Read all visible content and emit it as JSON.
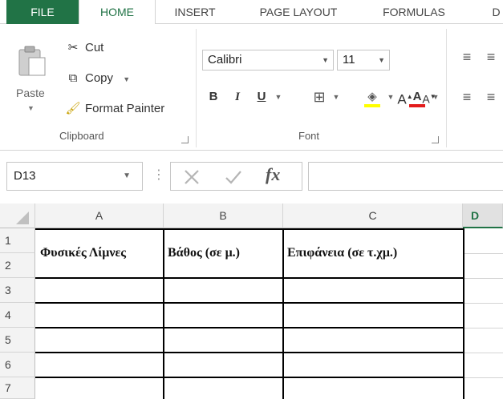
{
  "tabs": [
    "FILE",
    "HOME",
    "INSERT",
    "PAGE LAYOUT",
    "FORMULAS",
    "D"
  ],
  "clipboard": {
    "paste_label": "Paste",
    "cut_label": "Cut",
    "copy_label": "Copy",
    "format_painter_label": "Format Painter",
    "group_label": "Clipboard"
  },
  "font": {
    "font_name": "Calibri",
    "font_size": "11",
    "bold_label": "B",
    "italic_label": "I",
    "underline_label": "U",
    "group_label": "Font",
    "font_color_label": "A",
    "grow_label": "A",
    "shrink_label": "A"
  },
  "formula_bar": {
    "name_box": "D13",
    "fx_label": "fx",
    "value": ""
  },
  "grid": {
    "columns": [
      "A",
      "B",
      "C",
      "D"
    ],
    "rows": [
      "1",
      "2",
      "3",
      "4",
      "5",
      "6",
      "7"
    ],
    "header_cells": [
      "Φυσικές Λίμνες",
      "Βάθος (σε μ.)",
      "Επιφάνεια (σε τ.χμ.)"
    ]
  },
  "colors": {
    "accent": "#217346",
    "font_color_bar": "#e31c1c",
    "highlight_bar": "#ffff00"
  }
}
